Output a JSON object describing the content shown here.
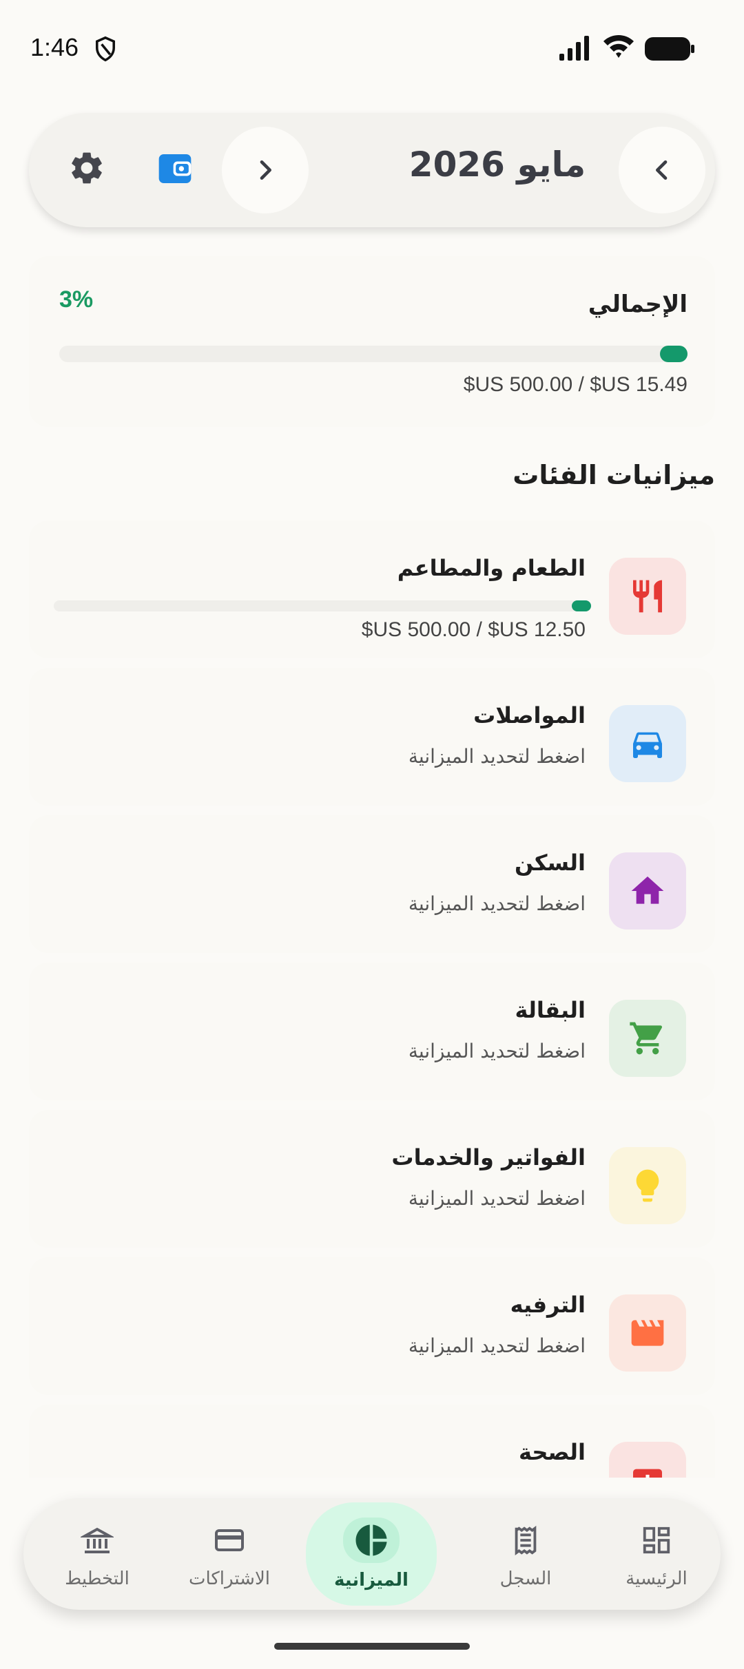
{
  "status_bar": {
    "time": "1:46"
  },
  "header": {
    "month_title": "مايو 2026"
  },
  "total": {
    "label": "الإجمالي",
    "percent": "3%",
    "amount": "$US 500.00 / $US 15.49",
    "progress_fraction": 0.03
  },
  "section": {
    "title": "ميزانيات الفئات"
  },
  "categories": [
    {
      "name": "الطعام والمطاعم",
      "amount": "$US 500.00 / $US 12.50",
      "progress_fraction": 0.025,
      "icon": "fork-knife-icon",
      "icon_bg": "#fae3e1",
      "icon_color": "#e53935"
    },
    {
      "name": "المواصلات",
      "subtitle": "اضغط لتحديد الميزانية",
      "icon": "car-icon",
      "icon_bg": "#e1edf8",
      "icon_color": "#1e88e5"
    },
    {
      "name": "السكن",
      "subtitle": "اضغط لتحديد الميزانية",
      "icon": "home-icon",
      "icon_bg": "#eee0f1",
      "icon_color": "#8e24aa"
    },
    {
      "name": "البقالة",
      "subtitle": "اضغط لتحديد الميزانية",
      "icon": "shopping-cart-icon",
      "icon_bg": "#e4f1e4",
      "icon_color": "#43a047"
    },
    {
      "name": "الفواتير والخدمات",
      "subtitle": "اضغط لتحديد الميزانية",
      "icon": "lightbulb-icon",
      "icon_bg": "#fbf5dd",
      "icon_color": "#fdd835"
    },
    {
      "name": "الترفيه",
      "subtitle": "اضغط لتحديد الميزانية",
      "icon": "clapperboard-icon",
      "icon_bg": "#fbe7e0",
      "icon_color": "#ff7043"
    },
    {
      "name": "الصحة",
      "icon": "medical-icon",
      "icon_bg": "#fae3e1",
      "icon_color": "#e53935"
    }
  ],
  "nav": {
    "items": [
      {
        "label": "الرئيسية",
        "icon": "dashboard-icon"
      },
      {
        "label": "السجل",
        "icon": "receipt-icon"
      },
      {
        "label": "الميزانية",
        "icon": "pie-chart-icon",
        "active": true
      },
      {
        "label": "الاشتراكات",
        "icon": "credit-card-icon"
      },
      {
        "label": "التخطيط",
        "icon": "bank-icon"
      }
    ]
  },
  "colors": {
    "accent": "#14996b",
    "background": "#fbfaf7"
  }
}
